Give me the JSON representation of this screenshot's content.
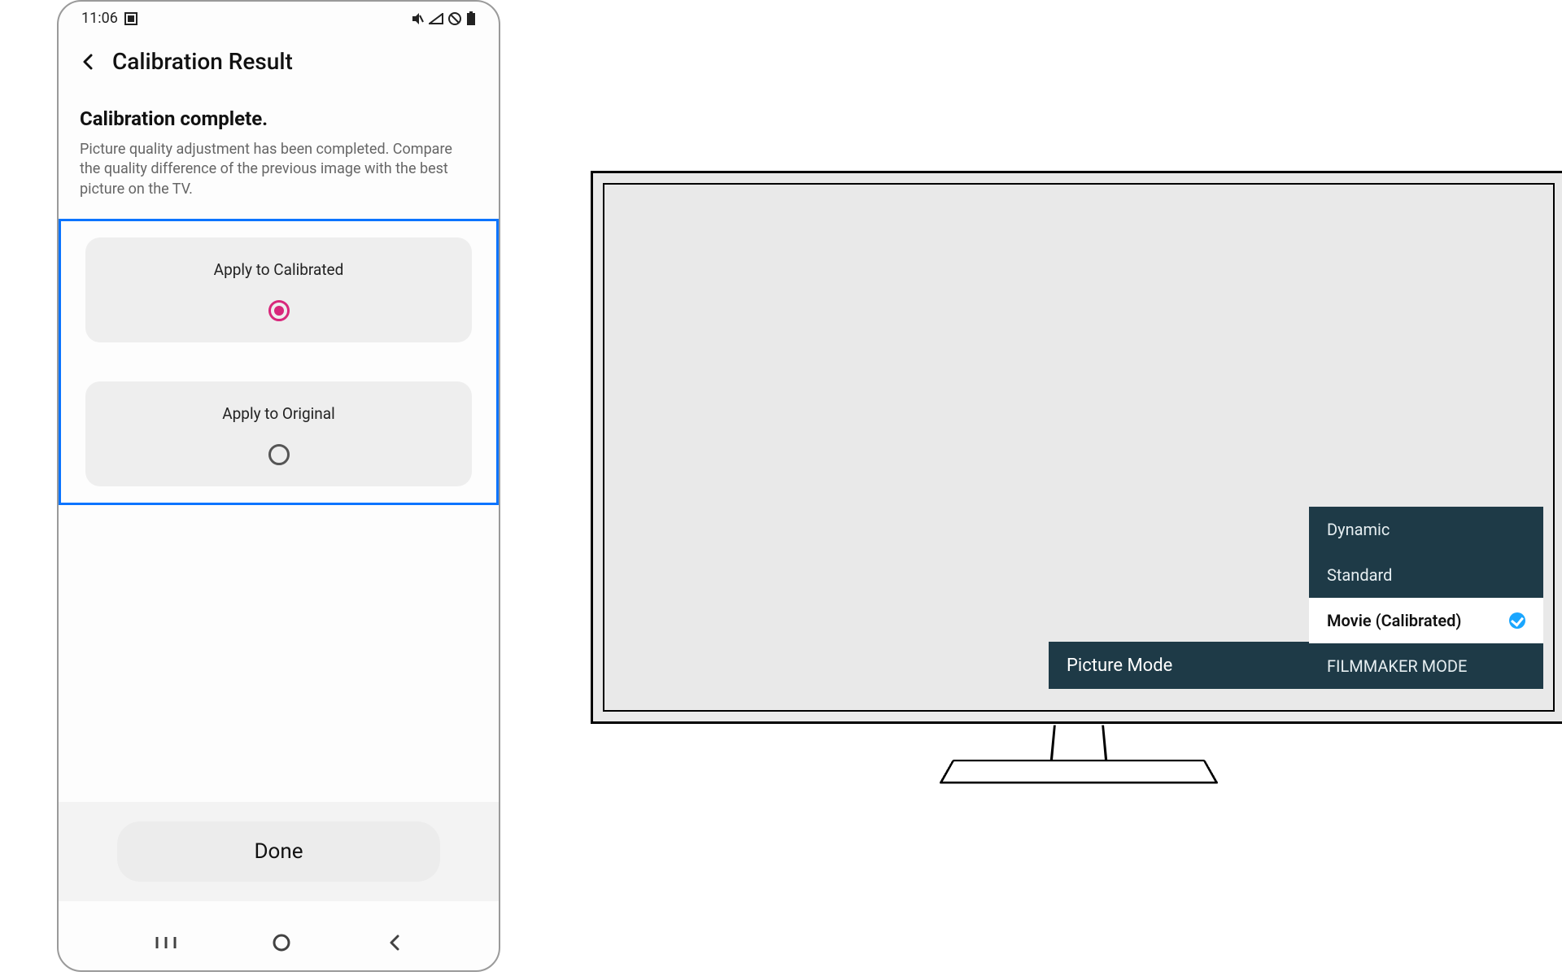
{
  "phone": {
    "status": {
      "time": "11:06",
      "icons_left": [
        "screenshot-icon"
      ],
      "icons_right": [
        "mute-icon",
        "nosignal-icon",
        "dnd-icon",
        "battery-icon"
      ]
    },
    "header": {
      "title": "Calibration Result"
    },
    "body": {
      "heading": "Calibration complete.",
      "description": "Picture quality adjustment has been completed. Compare the quality difference of the previous image with the best picture on the TV."
    },
    "options": [
      {
        "label": "Apply to Calibrated",
        "selected": true
      },
      {
        "label": "Apply to Original",
        "selected": false
      }
    ],
    "done_label": "Done"
  },
  "tv": {
    "picture_mode_label": "Picture Mode",
    "modes": [
      {
        "label": "Dynamic",
        "selected": false
      },
      {
        "label": "Standard",
        "selected": false
      },
      {
        "label": "Movie (Calibrated)",
        "selected": true
      },
      {
        "label": "FILMMAKER MODE",
        "selected": false
      }
    ]
  }
}
